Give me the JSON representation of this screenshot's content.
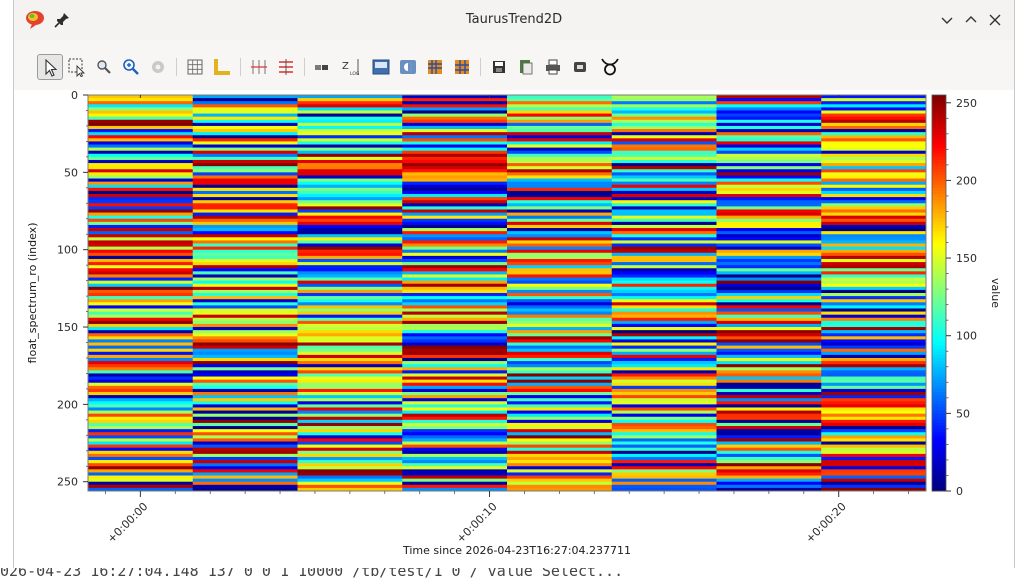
{
  "window": {
    "title": "TaurusTrend2D",
    "controls": [
      "minimize",
      "maximize",
      "close"
    ],
    "logo_icon": "taurus-logo-icon",
    "pin_icon": "pin-icon"
  },
  "toolbar": {
    "tools": [
      {
        "name": "pointer-tool",
        "icon": "arrow-pointer-icon",
        "active": true
      },
      {
        "name": "region-zoom-tool",
        "icon": "dashed-select-icon"
      },
      {
        "name": "zoom-tool",
        "icon": "magnifier-icon"
      },
      {
        "name": "zoom-reset-tool",
        "icon": "zoom-reset-icon"
      },
      {
        "name": "settings-tool",
        "icon": "gear-icon"
      },
      {
        "name": "grid-toggle",
        "icon": "grid-icon"
      },
      {
        "name": "axes-toggle",
        "icon": "axes-icon"
      },
      {
        "name": "vertical-cursor-tool",
        "icon": "vertical-cursor-icon"
      },
      {
        "name": "horizontal-cursor-tool",
        "icon": "horizontal-cursor-icon"
      },
      {
        "name": "colormap-tool",
        "icon": "colorbar-icon"
      },
      {
        "name": "z-log-toggle",
        "icon": "z-log-icon"
      },
      {
        "name": "image-view-tool",
        "icon": "image-icon"
      },
      {
        "name": "contrast-tool",
        "icon": "contrast-icon"
      },
      {
        "name": "x-profile-tool",
        "icon": "x-profile-icon"
      },
      {
        "name": "y-profile-tool",
        "icon": "y-profile-icon"
      },
      {
        "name": "save-button",
        "icon": "floppy-icon"
      },
      {
        "name": "copy-button",
        "icon": "copy-icon"
      },
      {
        "name": "print-button",
        "icon": "printer-icon"
      },
      {
        "name": "export-button",
        "icon": "export-icon"
      },
      {
        "name": "taurus-button",
        "icon": "taurus-symbol-icon"
      }
    ],
    "z_log_label": "Z",
    "z_log_sub": "LOG"
  },
  "chart_data": {
    "type": "heatmap",
    "title": "",
    "xlabel": "Time since 2026-04-23T16:27:04.237711",
    "ylabel": "float_spectrum_ro (index)",
    "colorbar_label": "value",
    "x_ticks": [
      "+0:00:00",
      "+0:00:10",
      "+0:00:20"
    ],
    "y_ticks": [
      "0",
      "50",
      "100",
      "150",
      "200",
      "250"
    ],
    "colorbar_ticks": [
      "0",
      "50",
      "100",
      "150",
      "200",
      "250"
    ],
    "y_range": [
      0,
      256
    ],
    "x_range_seconds": [
      -1.5,
      22.5
    ],
    "x_tick_values_seconds": [
      0,
      10,
      20
    ],
    "z_range": [
      0,
      255
    ],
    "n_columns": 8,
    "n_rows": 256,
    "colormap": "jet",
    "values_note_kind": "random"
  },
  "background_text": "026-04-23 16:27:04.148 137 0 0 1 10000   /tb/test/1  0  /  value  Select..."
}
